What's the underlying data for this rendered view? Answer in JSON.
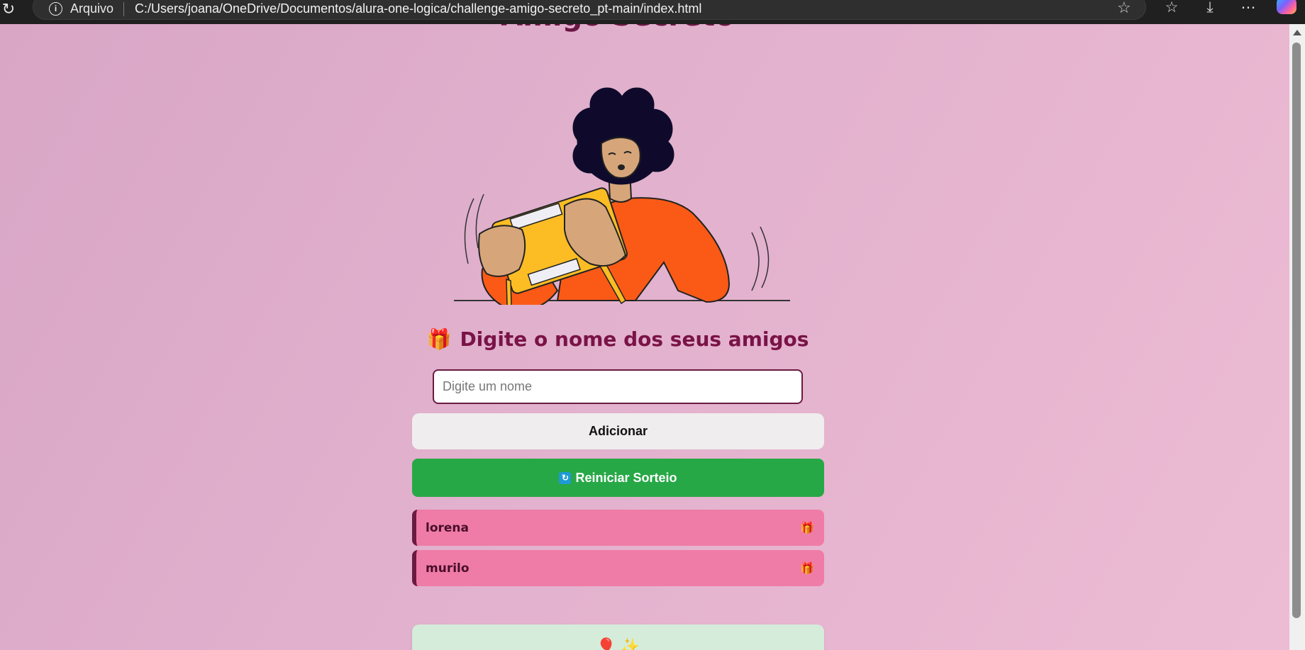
{
  "browser": {
    "scheme_label": "Arquivo",
    "url": "C:/Users/joana/OneDrive/Documentos/alura-one-logica/challenge-amigo-secreto_pt-main/index.html"
  },
  "page": {
    "title": "Amigo Secreto",
    "section_title": "Digite o nome dos seus amigos",
    "section_emoji": "🎁",
    "input_placeholder": "Digite um nome",
    "add_button": "Adicionar",
    "reset_icon": "🔄",
    "reset_button": "Reiniciar Sorteio",
    "friends": [
      {
        "name": "lorena",
        "icon": "🎁"
      },
      {
        "name": "murilo",
        "icon": "🎁"
      }
    ],
    "result": "🎈 ✨"
  },
  "colors": {
    "accent": "#7a1347",
    "reset_green": "#27a846",
    "friend_pink": "#ef7ca6",
    "result_green": "#d4ecd9"
  }
}
